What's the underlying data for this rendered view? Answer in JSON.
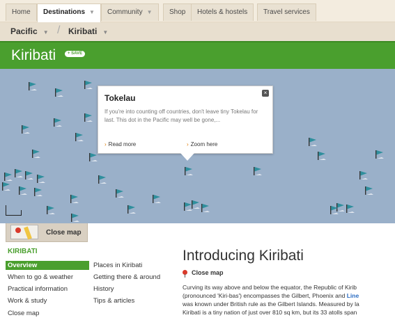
{
  "topnav": {
    "tabs": [
      {
        "label": "Home",
        "caret": false,
        "active": false
      },
      {
        "label": "Destinations",
        "caret": true,
        "active": true
      },
      {
        "label": "Community",
        "caret": true,
        "active": false
      },
      {
        "label": "Shop",
        "caret": false,
        "active": false
      },
      {
        "label": "Hotels & hostels",
        "caret": false,
        "active": false
      },
      {
        "label": "Travel services",
        "caret": false,
        "active": false
      }
    ]
  },
  "breadcrumb": {
    "items": [
      "Pacific",
      "Kiribati"
    ],
    "separator": "/"
  },
  "header": {
    "title": "Kiribati",
    "save_label": "+ SAVE"
  },
  "map": {
    "popup": {
      "title": "Tokelau",
      "text": "If you're into counting off countries, don't leave tiny Tokelau for last. This dot in the Pacific may well be gone,...",
      "read_more": "Read more",
      "zoom_here": "Zoom here",
      "close_glyph": "×"
    },
    "flag_color": "#2f8f9d",
    "water_color": "#9ab0c9"
  },
  "close_map_tab": {
    "label": "Close map"
  },
  "sidenav": {
    "heading": "KIRIBATI",
    "col1": [
      "Overview",
      "When to go & weather",
      "Practical information",
      "Work & study",
      "Close map"
    ],
    "col2": [
      "Places in Kiribati",
      "Getting there & around",
      "History",
      "Tips & articles"
    ],
    "active": "Overview"
  },
  "main": {
    "title": "Introducing Kiribati",
    "close_map_label": "Close map",
    "body_lines": [
      "Curving its way above and below the equator, the Republic of Kirib",
      "(pronounced 'Kiri-bas') encompasses the Gilbert, Phoenix and ",
      "was known under British rule as the Gilbert Islands. Measured by la",
      "Kiribati is a tiny nation of just over 810 sq km, but its 33 atolls span"
    ],
    "body_highlight": "Line"
  },
  "colors": {
    "accent_green": "#4a9f2e",
    "link_blue": "#2a6cc2",
    "pin_red": "#d93a2b",
    "arrow_orange": "#e07b00"
  }
}
